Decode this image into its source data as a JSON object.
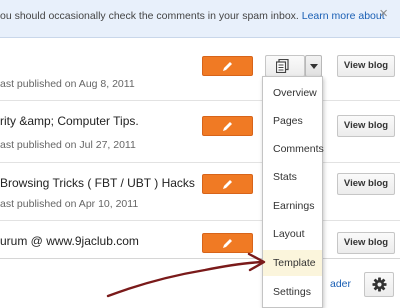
{
  "notice": {
    "text": "ou should occasionally check the comments in your spam inbox.",
    "link": "Learn more about",
    "close_icon": "×"
  },
  "blogs": [
    {
      "title": "",
      "meta": "ast published on Aug 8, 2011"
    },
    {
      "title": "rity &amp; Computer Tips.",
      "meta": "ast published on Jul 27, 2011"
    },
    {
      "title": "Browsing Tricks ( FBT / UBT ) Hacks",
      "meta": "ast published on Apr 10, 2011"
    },
    {
      "title": "urum @ www.9jaclub.com",
      "meta": ""
    }
  ],
  "buttons": {
    "view_blog": "View blog"
  },
  "dropdown": {
    "items": [
      "Overview",
      "Pages",
      "Comments",
      "Stats",
      "Earnings",
      "Layout",
      "Template",
      "Settings"
    ],
    "highlighted": "Template"
  },
  "footer": {
    "reader_link": "ader"
  },
  "colors": {
    "edit_button": "#f07a24",
    "notice_bg": "#e8f0fb",
    "link": "#1a5fb4",
    "menu_highlight": "#fbf5dc",
    "annotation_arrow": "#7a1a1a"
  },
  "icons": {
    "edit": "pencil-icon",
    "posts": "posts-list-icon",
    "dropdown": "caret-down-icon",
    "settings": "gear-icon",
    "close": "close-icon"
  }
}
